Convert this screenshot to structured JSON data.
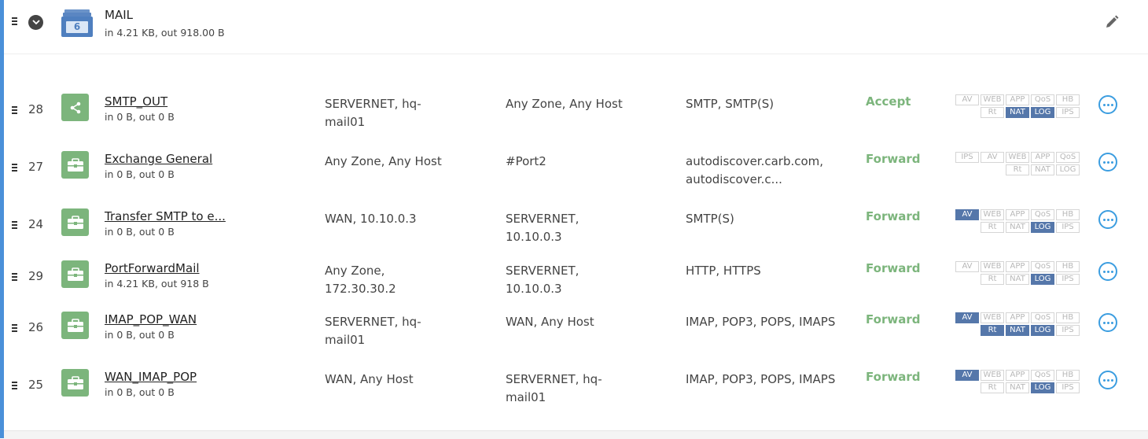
{
  "group": {
    "title": "MAIL",
    "count": "6",
    "traffic": "in 4.21 KB, out 918.00 B",
    "icons": {
      "collapse": "chevron-down-icon",
      "group": "stack-icon",
      "edit": "pencil-icon"
    }
  },
  "colors": {
    "accept": "#7cb57c",
    "active_badge": "#5577aa",
    "accent": "#4a90d9",
    "more": "#3b9de0"
  },
  "rules": [
    {
      "id": "28",
      "name": "SMTP_OUT",
      "traffic": "in 0 B, out 0 B",
      "icon": "share-icon",
      "source": "SERVERNET, hq-mail01",
      "destination": "Any Zone, Any Host",
      "services": "SMTP, SMTP(S)",
      "action": "Accept",
      "badges_top": [
        {
          "label": "AV",
          "on": false
        },
        {
          "label": "WEB",
          "on": false
        },
        {
          "label": "APP",
          "on": false
        },
        {
          "label": "QoS",
          "on": false
        },
        {
          "label": "HB",
          "on": false
        }
      ],
      "badges_bottom": [
        {
          "label": "Rt",
          "on": false
        },
        {
          "label": "NAT",
          "on": true
        },
        {
          "label": "LOG",
          "on": true
        },
        {
          "label": "IPS",
          "on": false
        }
      ]
    },
    {
      "id": "27",
      "name": "Exchange General",
      "traffic": "in 0 B, out 0 B",
      "icon": "briefcase-icon",
      "source": "Any Zone, Any Host",
      "destination": "#Port2",
      "services": "autodiscover.carb.com, autodiscover.c...",
      "action": "Forward",
      "badges_top": [
        {
          "label": "IPS",
          "on": false
        },
        {
          "label": "AV",
          "on": false
        },
        {
          "label": "WEB",
          "on": false
        },
        {
          "label": "APP",
          "on": false
        },
        {
          "label": "QoS",
          "on": false
        }
      ],
      "badges_bottom": [
        {
          "label": "Rt",
          "on": false
        },
        {
          "label": "NAT",
          "on": false
        },
        {
          "label": "LOG",
          "on": false
        }
      ]
    },
    {
      "id": "24",
      "name": "Transfer SMTP to e...",
      "traffic": "in 0 B, out 0 B",
      "icon": "briefcase-icon",
      "source": "WAN, 10.10.0.3",
      "destination": "SERVERNET, 10.10.0.3",
      "services": "SMTP(S)",
      "action": "Forward",
      "badges_top": [
        {
          "label": "AV",
          "on": true
        },
        {
          "label": "WEB",
          "on": false
        },
        {
          "label": "APP",
          "on": false
        },
        {
          "label": "QoS",
          "on": false
        },
        {
          "label": "HB",
          "on": false
        }
      ],
      "badges_bottom": [
        {
          "label": "Rt",
          "on": false
        },
        {
          "label": "NAT",
          "on": false
        },
        {
          "label": "LOG",
          "on": true
        },
        {
          "label": "IPS",
          "on": false
        }
      ]
    },
    {
      "id": "29",
      "name": "PortForwardMail",
      "traffic": "in 4.21 KB, out 918 B",
      "icon": "briefcase-icon",
      "source": "Any Zone, 172.30.30.2",
      "destination": "SERVERNET, 10.10.0.3",
      "services": "HTTP, HTTPS",
      "action": "Forward",
      "badges_top": [
        {
          "label": "AV",
          "on": false
        },
        {
          "label": "WEB",
          "on": false
        },
        {
          "label": "APP",
          "on": false
        },
        {
          "label": "QoS",
          "on": false
        },
        {
          "label": "HB",
          "on": false
        }
      ],
      "badges_bottom": [
        {
          "label": "Rt",
          "on": false
        },
        {
          "label": "NAT",
          "on": false
        },
        {
          "label": "LOG",
          "on": true
        },
        {
          "label": "IPS",
          "on": false
        }
      ]
    },
    {
      "id": "26",
      "name": "IMAP_POP_WAN",
      "traffic": "in 0 B, out 0 B",
      "icon": "briefcase-icon",
      "source": "SERVERNET, hq-mail01",
      "destination": "WAN, Any Host",
      "services": "IMAP, POP3, POPS, IMAPS",
      "action": "Forward",
      "badges_top": [
        {
          "label": "AV",
          "on": true
        },
        {
          "label": "WEB",
          "on": false
        },
        {
          "label": "APP",
          "on": false
        },
        {
          "label": "QoS",
          "on": false
        },
        {
          "label": "HB",
          "on": false
        }
      ],
      "badges_bottom": [
        {
          "label": "Rt",
          "on": true
        },
        {
          "label": "NAT",
          "on": true
        },
        {
          "label": "LOG",
          "on": true
        },
        {
          "label": "IPS",
          "on": false
        }
      ]
    },
    {
      "id": "25",
      "name": "WAN_IMAP_POP",
      "traffic": "in 0 B, out 0 B",
      "icon": "briefcase-icon",
      "source": "WAN, Any Host",
      "destination": "SERVERNET, hq-mail01",
      "services": "IMAP, POP3, POPS, IMAPS",
      "action": "Forward",
      "badges_top": [
        {
          "label": "AV",
          "on": true
        },
        {
          "label": "WEB",
          "on": false
        },
        {
          "label": "APP",
          "on": false
        },
        {
          "label": "QoS",
          "on": false
        },
        {
          "label": "HB",
          "on": false
        }
      ],
      "badges_bottom": [
        {
          "label": "Rt",
          "on": false
        },
        {
          "label": "NAT",
          "on": false
        },
        {
          "label": "LOG",
          "on": true
        },
        {
          "label": "IPS",
          "on": false
        }
      ]
    }
  ]
}
